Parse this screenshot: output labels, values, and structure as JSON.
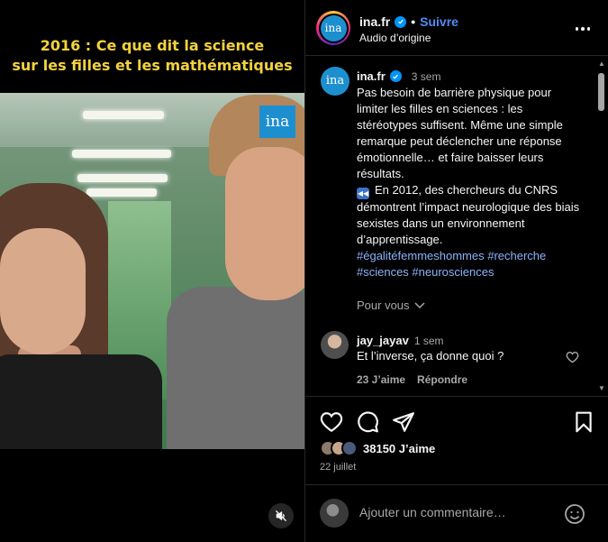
{
  "video": {
    "title_line1": "2016 : Ce que dit la science",
    "title_line2": "sur les filles et les mathématiques",
    "watermark": "ina"
  },
  "header": {
    "username": "ina.fr",
    "separator": "•",
    "follow_label": "Suivre",
    "audio_label": "Audio d’origine",
    "avatar_text": "ina"
  },
  "caption": {
    "avatar_text": "ina",
    "username": "ina.fr",
    "time": "3 sem",
    "paragraph1": "Pas besoin de barrière physique pour limiter les filles en sciences : les stéréotypes suffisent. Même une simple remarque peut déclencher une réponse émotionnelle… et faire baisser leurs résultats.",
    "paragraph2": "En 2012, des chercheurs du CNRS démontrent l’impact neurologique des biais sexistes dans un environnement d’apprentissage.",
    "hashtags": "#égalitéfemmeshommes #recherche #sciences #neurosciences",
    "for_you_label": "Pour vous"
  },
  "comment": {
    "username": "jay_jayav",
    "time": "1 sem",
    "text": "Et l’inverse, ça donne quoi ?",
    "likes": "23 J’aime",
    "reply_label": "Répondre"
  },
  "likes": {
    "count_text": "38150 J’aime",
    "date": "22 juillet"
  },
  "composer": {
    "placeholder": "Ajouter un commentaire…"
  },
  "colors": {
    "accent_link": "#4f8cf6",
    "hashtag": "#8ab4f8",
    "verified": "#0095f6",
    "video_title": "#f3d23d",
    "ina_blue": "#1d8fcf"
  },
  "icons": [
    "verified-icon",
    "more-options-icon",
    "chevron-down-icon",
    "heart-icon",
    "comment-icon",
    "share-icon",
    "bookmark-icon",
    "emoji-icon",
    "mute-icon"
  ]
}
